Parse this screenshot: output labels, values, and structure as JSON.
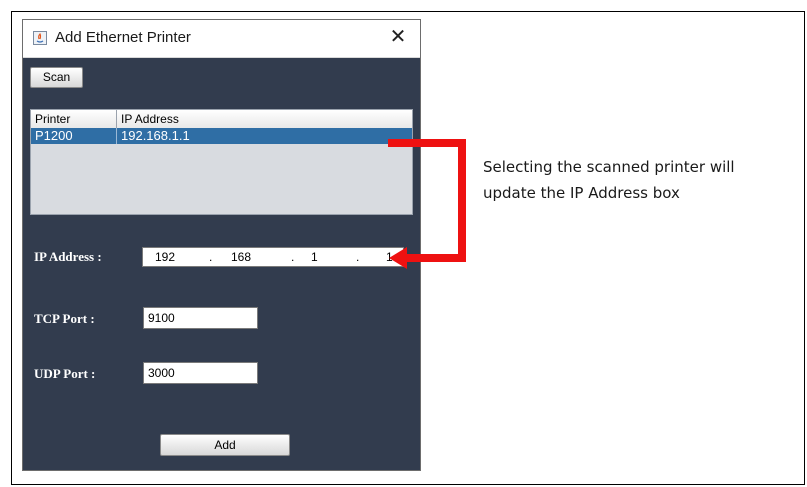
{
  "dialog": {
    "title": "Add Ethernet Printer",
    "close_label": "✕",
    "scan_label": "Scan",
    "add_label": "Add"
  },
  "table": {
    "headers": [
      "Printer",
      "IP Address"
    ],
    "rows": [
      {
        "printer": "P1200",
        "ip": "192.168.1.1"
      }
    ]
  },
  "fields": {
    "ip_label": "IP Address :",
    "ip_parts": [
      "192",
      "168",
      "1",
      "1"
    ],
    "ip_dot": ".",
    "tcp_label": "TCP Port :",
    "tcp_value": "9100",
    "udp_label": "UDP Port :",
    "udp_value": "3000"
  },
  "annotation": {
    "line1": "Selecting the scanned printer will",
    "line2": "update the IP Address box"
  },
  "colors": {
    "dialog_bg": "#323c4e",
    "selection": "#2f6ea5",
    "arrow": "#ee1111"
  },
  "icons": {
    "window": "java-app-icon",
    "close": "close-icon"
  }
}
